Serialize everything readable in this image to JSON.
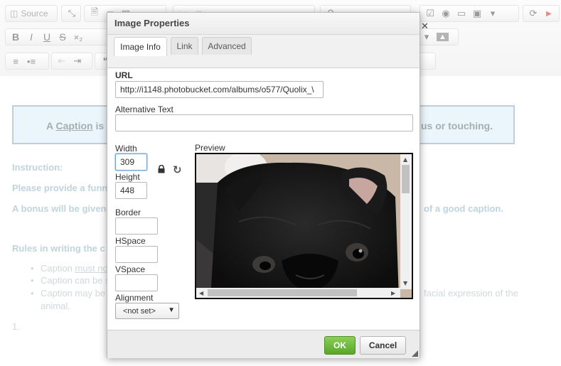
{
  "toolbar": {
    "source_label": "Source"
  },
  "document": {
    "caption_left": "A ",
    "caption_word": "Caption",
    "caption_mid": " is",
    "caption_right": "us or touching.",
    "instruction_heading": "Instruction:",
    "instruction_line1": "Please provide a funn",
    "instruction_line2_left": "A bonus will be given",
    "instruction_line2_right": "of a good caption.",
    "rules_heading": "Rules in writing the c",
    "rule1_left": "Caption ",
    "rule1_underlined": "must no",
    "rule2_left": "Caption can be s",
    "rule3_left": "Caption may be",
    "rule3_right": "facial expression of the",
    "rule3_cont": "animal.",
    "list_number": "1."
  },
  "dialog": {
    "title": "Image Properties",
    "tabs": [
      {
        "label": "Image Info",
        "active": true
      },
      {
        "label": "Link",
        "active": false
      },
      {
        "label": "Advanced",
        "active": false
      }
    ],
    "url_label": "URL",
    "url_value": "http://i1148.photobucket.com/albums/o577/Quolix_\\",
    "alt_label": "Alternative Text",
    "alt_value": "",
    "width_label": "Width",
    "width_value": "309",
    "height_label": "Height",
    "height_value": "448",
    "border_label": "Border",
    "border_value": "",
    "hspace_label": "HSpace",
    "hspace_value": "",
    "vspace_label": "VSpace",
    "vspace_value": "",
    "preview_label": "Preview",
    "alignment_label": "Alignment",
    "alignment_value": "<not set>",
    "ok_label": "OK",
    "cancel_label": "Cancel"
  },
  "colors": {
    "ok_green": "#5aa629",
    "caption_bg": "#d9eef9",
    "focus_blue": "#6a9fd4"
  }
}
